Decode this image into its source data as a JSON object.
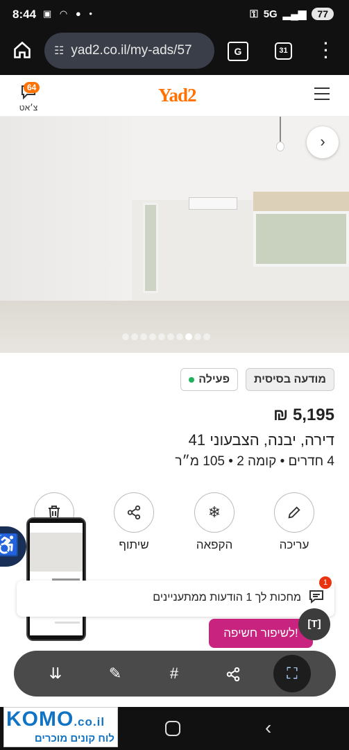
{
  "status_bar": {
    "time": "8:44",
    "network": "5G",
    "battery": "77"
  },
  "browser": {
    "url": "yad2.co.il/my-ads/57",
    "tabs_count": "31"
  },
  "header": {
    "logo": "Yad2",
    "chat_label": "צ׳אט",
    "chat_badge": "64"
  },
  "gallery": {
    "photo_count": 10,
    "active_index": 7
  },
  "listing": {
    "plan_chip": "מודעה בסיסית",
    "status_chip": "פעילה",
    "price": "5,195 ₪",
    "address": "דירה, יבנה, הצבעוני 41",
    "specs": "4 חדרים  •  קומה 2  •  105 מ״ר"
  },
  "actions": {
    "edit": "עריכה",
    "freeze": "הקפאה",
    "share": "שיתוף"
  },
  "notice": {
    "text": "מחכות לך 1 הודעות ממתעניינים",
    "badge": "1"
  },
  "promo": {
    "improve_label": "לשיפור חשיפה!"
  },
  "watermark": {
    "brand": "KOMO",
    "tld": ".co.il",
    "tagline": "לוח קונים מוכרים"
  },
  "colors": {
    "brand": "#ff7100",
    "promo": "#c8237f",
    "active": "#21b15b",
    "accessibility": "#1a2f55"
  }
}
